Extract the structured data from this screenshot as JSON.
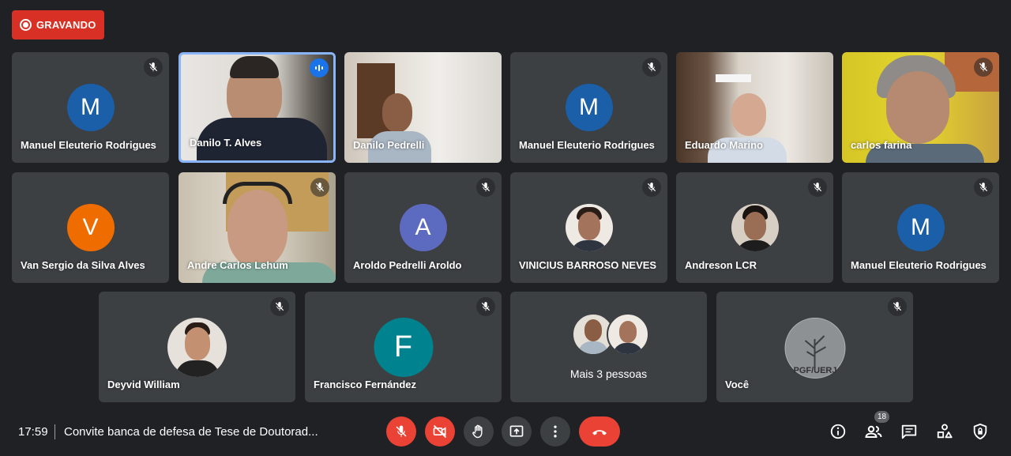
{
  "recording": {
    "label": "GRAVANDO"
  },
  "participants": {
    "p1": {
      "name": "Manuel Eleuterio Rodrigues",
      "initial": "M",
      "color": "#1a5fa8"
    },
    "p2": {
      "name": "Danilo T. Alves"
    },
    "p3": {
      "name": "Danilo Pedrelli"
    },
    "p4": {
      "name": "Manuel Eleuterio Rodrigues",
      "initial": "M",
      "color": "#1a5fa8"
    },
    "p5": {
      "name": "Eduardo Marino"
    },
    "p6": {
      "name": "carlos farina"
    },
    "p7": {
      "name": "Van Sergio da Silva Alves",
      "initial": "V",
      "color": "#ef6c00"
    },
    "p8": {
      "name": "Andre Carlos Lehum"
    },
    "p9": {
      "name": "Aroldo Pedrelli Aroldo",
      "initial": "A",
      "color": "#5c6bc0"
    },
    "p10": {
      "name": "VINICIUS BARROSO NEVES"
    },
    "p11": {
      "name": "Andreson LCR"
    },
    "p12": {
      "name": "Manuel Eleuterio Rodrigues",
      "initial": "M",
      "color": "#1a5fa8"
    },
    "p13": {
      "name": "Deyvid William"
    },
    "p14": {
      "name": "Francisco Fernández",
      "initial": "F",
      "color": "#00838f"
    },
    "p15": {
      "name": "Mais 3 pessoas"
    },
    "p16": {
      "name": "Você",
      "watermark": "PGF/UERJ"
    }
  },
  "bottom": {
    "time": "17:59",
    "meeting_title": "Convite banca de defesa de Tese de Doutorad...",
    "participant_count": "18"
  },
  "icons": {
    "mic_off": "mic-off-icon",
    "cam_off": "camera-off-icon",
    "hand": "raise-hand-icon",
    "present": "present-screen-icon",
    "more": "more-options-icon",
    "hangup": "hang-up-icon",
    "info": "info-icon",
    "people": "people-icon",
    "chat": "chat-icon",
    "activities": "activities-icon",
    "lock": "host-controls-icon"
  }
}
